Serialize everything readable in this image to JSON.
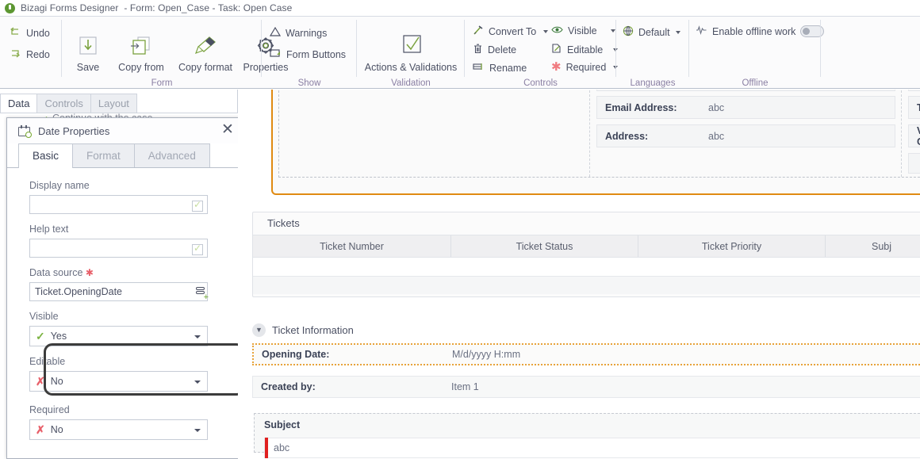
{
  "window": {
    "app_title": "Bizagi Forms Designer",
    "title_suffix": "- Form: Open_Case - Task:  Open Case",
    "logo_icon": "bizagi-logo-icon"
  },
  "ribbon": {
    "undo_redo": {
      "undo": "Undo",
      "redo": "Redo"
    },
    "groups": [
      {
        "label": "Form"
      },
      {
        "label": "Show"
      },
      {
        "label": "Validation"
      },
      {
        "label": "Controls"
      },
      {
        "label": "Languages"
      },
      {
        "label": "Offline"
      }
    ],
    "form": {
      "save": "Save",
      "copy_from": "Copy from",
      "copy_format": "Copy format",
      "properties": "Properties"
    },
    "show": {
      "warnings": "Warnings",
      "form_buttons": "Form Buttons"
    },
    "validation": {
      "actions_validations": "Actions & Validations"
    },
    "controls": {
      "convert_to": "Convert To",
      "delete": "Delete",
      "rename": "Rename"
    },
    "controls2": {
      "visible": "Visible",
      "editable": "Editable",
      "required": "Required"
    },
    "languages": {
      "default": "Default"
    },
    "offline": {
      "enable_offline_work": "Enable offline work",
      "toggle_state": "off"
    }
  },
  "left_panel": {
    "tabs": [
      {
        "label": "Data",
        "active": true
      },
      {
        "label": "Controls",
        "active": false
      },
      {
        "label": "Layout",
        "active": false
      }
    ],
    "behind_text": "Continue with the case"
  },
  "dialog": {
    "title": "Date Properties",
    "title_icon": "calendar-clock-icon",
    "close_icon": "close-icon",
    "tabs": [
      {
        "label": "Basic",
        "active": true
      },
      {
        "label": "Format",
        "active": false
      },
      {
        "label": "Advanced",
        "active": false
      }
    ],
    "fields": {
      "display_name": {
        "label": "Display name",
        "value": ""
      },
      "help_text": {
        "label": "Help text",
        "value": ""
      },
      "data_source": {
        "label": "Data source",
        "required_marker": "✱",
        "value": "Ticket.OpeningDate"
      },
      "visible": {
        "label": "Visible",
        "value": "Yes",
        "marker": "✓"
      },
      "editable": {
        "label": "Editable",
        "value": "No",
        "marker": "✗",
        "highlighted": true
      },
      "required": {
        "label": "Required",
        "value": "No",
        "marker": "✗"
      }
    }
  },
  "canvas": {
    "top_card": {
      "email_address": {
        "label": "Email Address:",
        "value": "abc"
      },
      "address": {
        "label": "Address:",
        "value": "abc"
      },
      "telephone": {
        "label": "Telep"
      },
      "vip": {
        "label": "VIP C"
      }
    },
    "tickets": {
      "title": "Tickets",
      "columns": [
        "Ticket Number",
        "Ticket Status",
        "Ticket Priority",
        "Subj"
      ]
    },
    "ticket_information": {
      "section_title": "Ticket Information",
      "collapse_icon": "chevron-down-icon",
      "rows": [
        {
          "label": "Opening Date:",
          "value": "M/d/yyyy H:mm",
          "selected": true
        },
        {
          "label": "Created by:",
          "value": "Item 1",
          "selected": false
        }
      ],
      "subject": {
        "title": "Subject",
        "value": "abc"
      }
    }
  }
}
